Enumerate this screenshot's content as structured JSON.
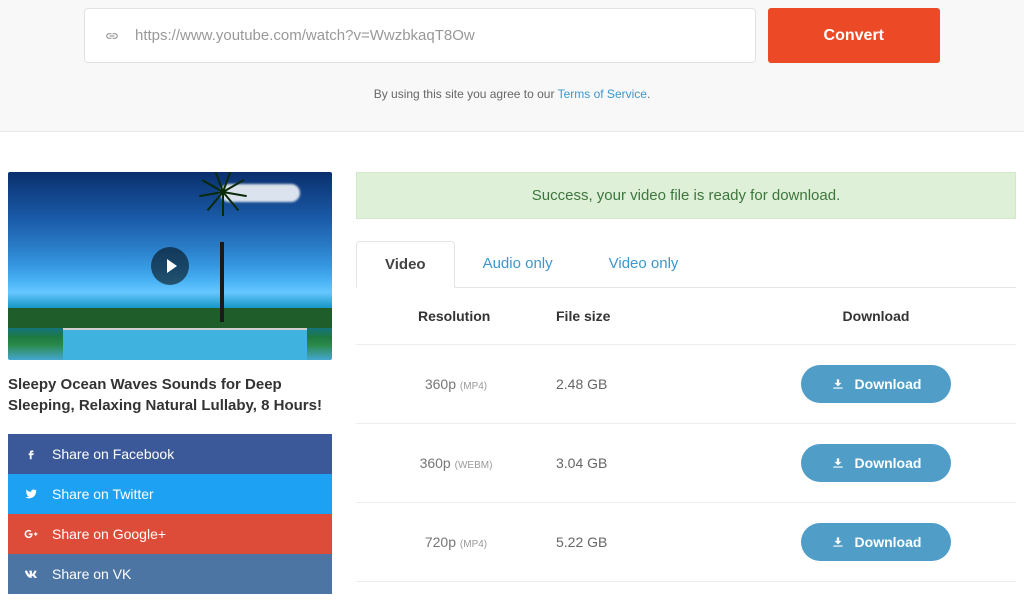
{
  "header": {
    "url": "https://www.youtube.com/watch?v=WwzbkaqT8Ow",
    "convert_label": "Convert",
    "terms_prefix": "By using this site you agree to our ",
    "terms_link": "Terms of Service",
    "terms_suffix": "."
  },
  "video": {
    "title": "Sleepy Ocean Waves Sounds for Deep Sleeping, Relaxing Natural Lullaby, 8 Hours!"
  },
  "share": {
    "facebook": "Share on Facebook",
    "twitter": "Share on Twitter",
    "google": "Share on Google+",
    "vk": "Share on VK"
  },
  "status": {
    "success": "Success, your video file is ready for download."
  },
  "tabs": {
    "video": "Video",
    "audio_only": "Audio only",
    "video_only": "Video only"
  },
  "table": {
    "headers": {
      "resolution": "Resolution",
      "filesize": "File size",
      "download": "Download"
    },
    "download_label": "Download",
    "rows": [
      {
        "res": "360p",
        "format": "(MP4)",
        "size": "2.48 GB"
      },
      {
        "res": "360p",
        "format": "(WEBM)",
        "size": "3.04 GB"
      },
      {
        "res": "720p",
        "format": "(MP4)",
        "size": "5.22 GB"
      }
    ]
  }
}
